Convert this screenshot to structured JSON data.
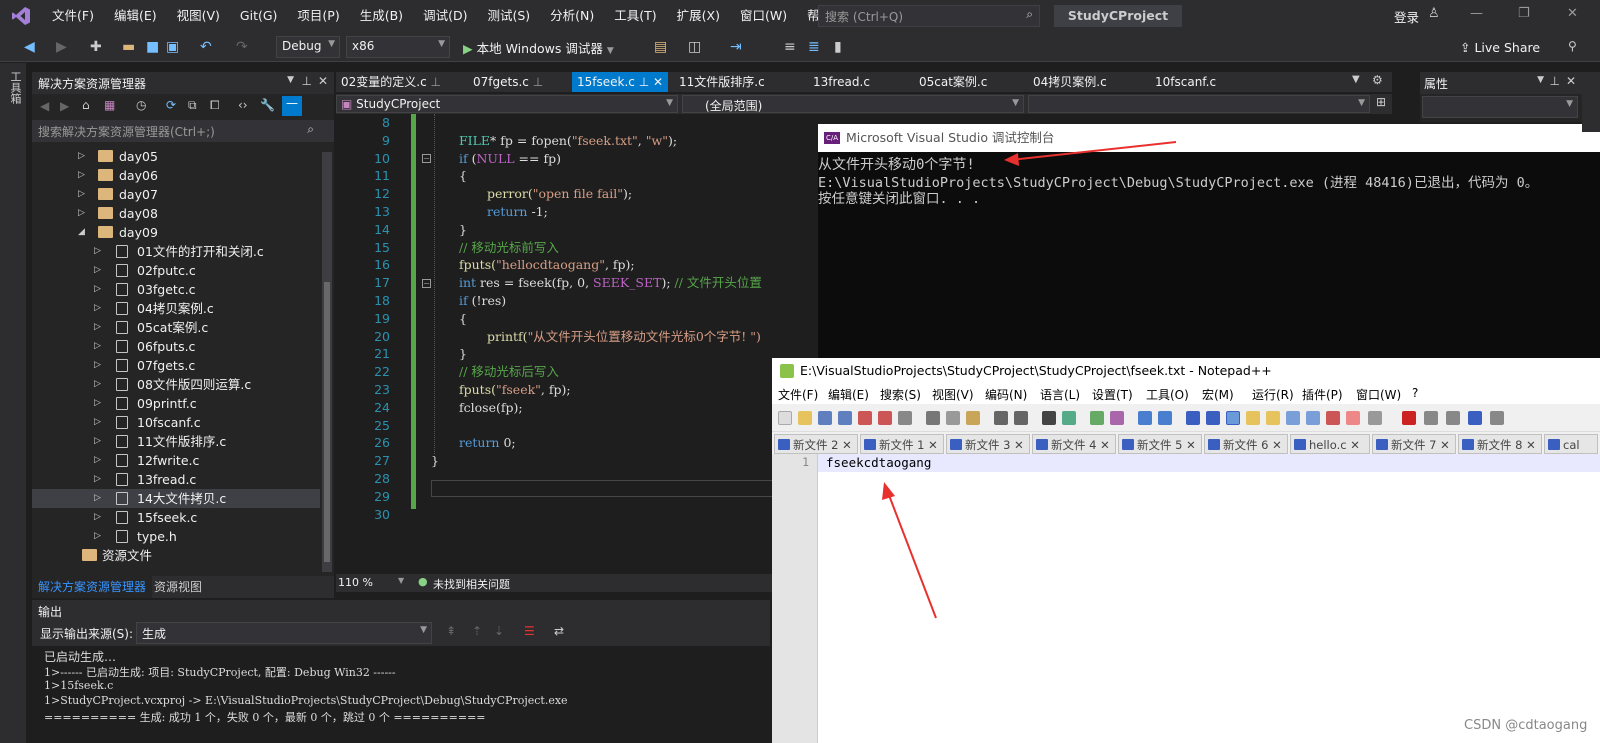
{
  "menubar": {
    "items": [
      "文件(F)",
      "编辑(E)",
      "视图(V)",
      "Git(G)",
      "项目(P)",
      "生成(B)",
      "调试(D)",
      "测试(S)",
      "分析(N)",
      "工具(T)",
      "扩展(X)",
      "窗口(W)",
      "帮助(H)"
    ],
    "search_placeholder": "搜索 (Ctrl+Q)",
    "project_title": "StudyCProject",
    "login": "登录"
  },
  "toolbar": {
    "config": "Debug",
    "platform": "x86",
    "run_label": "本地 Windows 调试器",
    "live_share": "Live Share"
  },
  "left_strip": {
    "label": "工具箱"
  },
  "solution_explorer": {
    "title": "解决方案资源管理器",
    "search_placeholder": "搜索解决方案资源管理器(Ctrl+;)",
    "folders": [
      "day05",
      "day06",
      "day07",
      "day08",
      "day09"
    ],
    "files": [
      "01文件的打开和关闭.c",
      "02fputc.c",
      "03fgetc.c",
      "04拷贝案例.c",
      "05cat案例.c",
      "06fputs.c",
      "07fgets.c",
      "08文件版四则运算.c",
      "09printf.c",
      "10fscanf.c",
      "11文件版排序.c",
      "12fwrite.c",
      "13fread.c",
      "14大文件拷贝.c",
      "15fseek.c",
      "type.h"
    ],
    "resource_folder": "资源文件",
    "tabs": [
      "解决方案资源管理器",
      "资源视图"
    ]
  },
  "editor": {
    "tabs": [
      "02变量的定义.c",
      "07fgets.c",
      "15fseek.c",
      "11文件版排序.c",
      "13fread.c",
      "05cat案例.c",
      "04拷贝案例.c",
      "10fscanf.c"
    ],
    "active_tab": "15fseek.c",
    "nav_project": "StudyCProject",
    "nav_scope": "(全局范围)",
    "line_numbers": [
      "8",
      "9",
      "10",
      "11",
      "12",
      "13",
      "14",
      "15",
      "16",
      "17",
      "18",
      "19",
      "20",
      "21",
      "22",
      "23",
      "24",
      "25",
      "26",
      "27",
      "28",
      "29",
      "30"
    ],
    "code": {
      "l9_type": "FILE",
      "l9_rest": "* fp = fopen(",
      "l9_s1": "\"fseek.txt\"",
      "l9_c": ", ",
      "l9_s2": "\"w\"",
      "l9_end": ");",
      "l10_kw": "if",
      "l10_a": " (",
      "l10_mac": "NULL",
      "l10_b": " == fp)",
      "l11": "{",
      "l12_a": "perror(",
      "l12_s": "\"open file fail\"",
      "l12_b": ");",
      "l13_kw": "return",
      "l13_b": " -1;",
      "l14": "}",
      "l15": "// 移动光标前写入",
      "l16_a": "fputs(",
      "l16_s": "\"hellocdtaogang\"",
      "l16_b": ", fp);",
      "l17_kw": "int",
      "l17_a": " res = fseek(fp, 0, ",
      "l17_mac": "SEEK_SET",
      "l17_b": "); ",
      "l17_c": "// 文件开头位置",
      "l18_kw": "if",
      "l18_b": " (!res)",
      "l19": "{",
      "l20_a": "printf(",
      "l20_s": "\"从文件开头位置移动文件光标0个字节! \")",
      "l21": "}",
      "l22": "// 移动光标后写入",
      "l23_a": "fputs(",
      "l23_s": "\"fseek\"",
      "l23_b": ", fp);",
      "l24": "fclose(fp);",
      "l26_kw": "return",
      "l26_b": " 0;",
      "l27": "}"
    },
    "zoom": "110 %",
    "status": "未找到相关问题"
  },
  "console": {
    "title": "Microsoft Visual Studio 调试控制台",
    "icon_text": "C/A",
    "lines": [
      "从文件开头移动0个字节!",
      "E:\\VisualStudioProjects\\StudyCProject\\Debug\\StudyCProject.exe (进程 48416)已退出，代码为 0。",
      "按任意键关闭此窗口. . ."
    ]
  },
  "notepad": {
    "title": "E:\\VisualStudioProjects\\StudyCProject\\StudyCProject\\fseek.txt - Notepad++",
    "menu": [
      "文件(F)",
      "编辑(E)",
      "搜索(S)",
      "视图(V)",
      "编码(N)",
      "语言(L)",
      "设置(T)",
      "工具(O)",
      "宏(M)",
      "运行(R)",
      "插件(P)",
      "窗口(W)",
      "?"
    ],
    "tabs": [
      "新文件 2",
      "新文件 1",
      "新文件 3",
      "新文件 4",
      "新文件 5",
      "新文件 6",
      "hello.c",
      "新文件 7",
      "新文件 8",
      "cal"
    ],
    "line_number": "1",
    "content": "fseekcdtaogang"
  },
  "output": {
    "title": "输出",
    "source_label": "显示输出来源(S):",
    "source_value": "生成",
    "lines": [
      "已启动生成…",
      "1>------ 已启动生成: 项目: StudyCProject, 配置: Debug Win32 ------",
      "1>15fseek.c",
      "1>StudyCProject.vcxproj -> E:\\VisualStudioProjects\\StudyCProject\\Debug\\StudyCProject.exe",
      "========== 生成: 成功 1 个，失败 0 个，最新 0 个，跳过 0 个 =========="
    ]
  },
  "props": {
    "title": "属性"
  },
  "watermark": "CSDN @cdtaogang",
  "colors": {
    "accent": "#007acc",
    "arrow": "#e8312f",
    "ide_bg": "#1e1e1e"
  }
}
